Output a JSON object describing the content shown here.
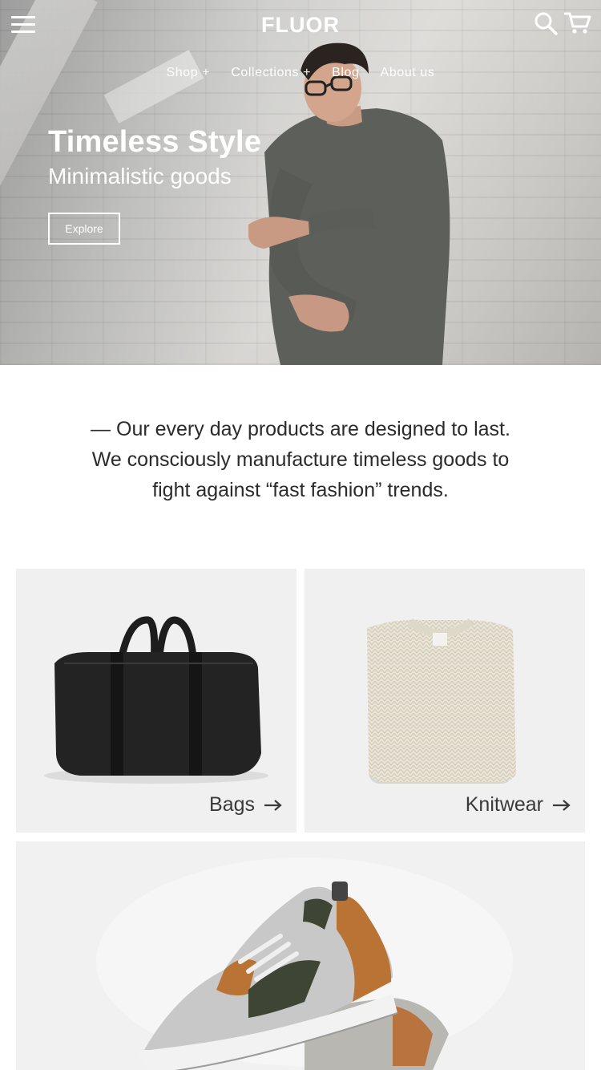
{
  "header": {
    "brand": "FLUOR",
    "nav": [
      {
        "label": "Shop +"
      },
      {
        "label": "Collections +"
      },
      {
        "label": "Blog"
      },
      {
        "label": "About us"
      }
    ],
    "icons": {
      "menu": "hamburger-menu-icon",
      "search": "search-icon",
      "cart": "cart-icon"
    }
  },
  "hero": {
    "title": "Timeless Style",
    "subtitle": "Minimalistic goods",
    "cta_label": "Explore"
  },
  "intro": {
    "text": "— Our every day products are designed to last. We consciously manufacture timeless goods to fight against “fast fashion” trends."
  },
  "categories": [
    {
      "label": "Bags"
    },
    {
      "label": "Knitwear"
    }
  ],
  "colors": {
    "text": "#2b2b2b",
    "tile_bg": "#f0f0f0",
    "hero_text": "#ffffff"
  }
}
